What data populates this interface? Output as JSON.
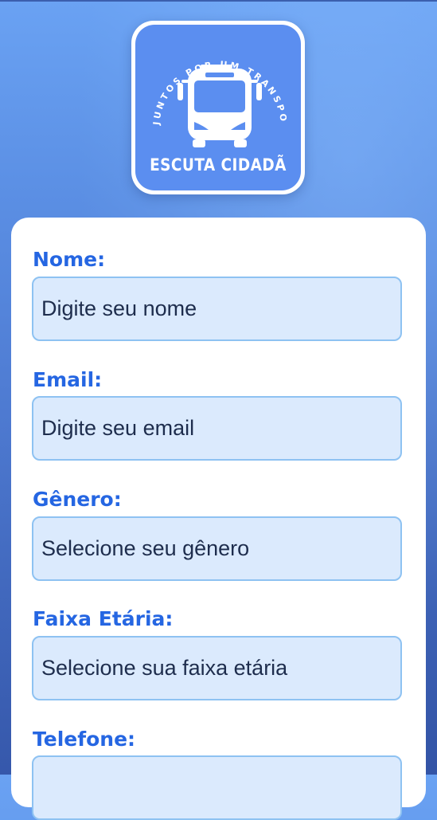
{
  "app": {
    "logo_arc_text": "JUNTOS POR UM TRANSPORTE MELHOR",
    "logo_title": "ESCUTA CIDADÃ",
    "brand_color": "#5b8ef0",
    "accent_color": "#2566e2"
  },
  "form": {
    "nome": {
      "label": "Nome:",
      "placeholder": "Digite seu nome"
    },
    "email": {
      "label": "Email:",
      "placeholder": "Digite seu email"
    },
    "genero": {
      "label": "Gênero:",
      "selected": "Selecione seu gênero"
    },
    "faixa_etaria": {
      "label": "Faixa Etária:",
      "selected": "Selecione sua faixa etária"
    },
    "telefone": {
      "label": "Telefone:",
      "placeholder": ""
    }
  },
  "icons": {
    "logo": "bus-icon"
  }
}
